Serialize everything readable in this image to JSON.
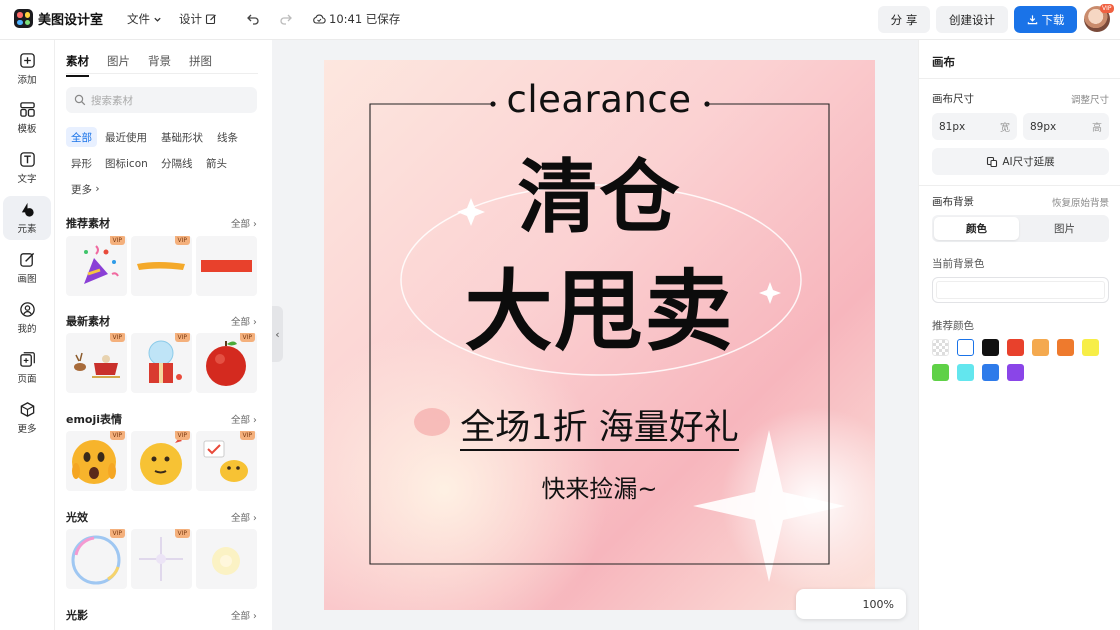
{
  "app": {
    "name": "美图设计室"
  },
  "topbar": {
    "file_label": "文件",
    "design_label": "设计",
    "save_status": "10:41 已保存",
    "share_label": "分 享",
    "create_label": "创建设计",
    "download_label": "下载",
    "avatar_badge": "VIP"
  },
  "leftnav": [
    {
      "label": "添加",
      "icon": "plus-square-icon"
    },
    {
      "label": "模板",
      "icon": "template-icon"
    },
    {
      "label": "文字",
      "icon": "text-icon"
    },
    {
      "label": "元素",
      "icon": "shapes-icon",
      "active": true
    },
    {
      "label": "画图",
      "icon": "pen-icon"
    },
    {
      "label": "我的",
      "icon": "user-icon"
    },
    {
      "label": "页面",
      "icon": "add-page-icon"
    },
    {
      "label": "更多",
      "icon": "cube-icon"
    }
  ],
  "panel": {
    "tabs": [
      "素材",
      "图片",
      "背景",
      "拼图"
    ],
    "search_placeholder": "搜索素材",
    "chips": [
      "全部",
      "最近使用",
      "基础形状",
      "线条",
      "异形",
      "图标icon",
      "分隔线",
      "箭头",
      "更多"
    ],
    "all_label": "全部",
    "vip_label": "VIP",
    "sections": [
      "推荐素材",
      "最新素材",
      "emoji表情",
      "光效",
      "光影"
    ]
  },
  "canvas": {
    "en_title": "clearance",
    "title_line1": "清仓",
    "title_line2": "大甩卖",
    "subtitle": "全场1折  海量好礼",
    "tagline": "快来捡漏~",
    "zoom": "100%"
  },
  "rpanel": {
    "title": "画布",
    "size_label": "画布尺寸",
    "adjust_label": "调整尺寸",
    "width_value": "81px",
    "width_unit": "宽",
    "height_value": "89px",
    "height_unit": "高",
    "ai_extend_label": "AI尺寸延展",
    "bg_label": "画布背景",
    "restore_label": "恢复原始背景",
    "color_tab": "颜色",
    "image_tab": "图片",
    "current_bg_label": "当前背景色",
    "recommend_label": "推荐颜色",
    "colors": [
      "transparent",
      "#ffffff",
      "#111111",
      "#e8412c",
      "#f4a94f",
      "#ee7a2d",
      "#f7ee47",
      "#5fd147",
      "#63e6ee",
      "#2e7bea",
      "#8a45e8"
    ]
  },
  "theme": {
    "accent": "#1a73e8",
    "download_bg": "#1a73e8"
  }
}
